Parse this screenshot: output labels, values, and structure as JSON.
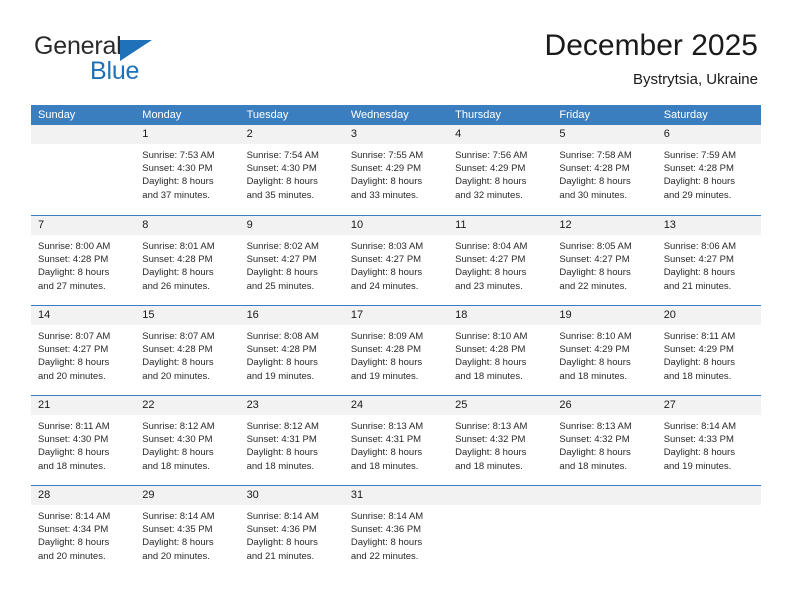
{
  "brand": {
    "name_part1": "General",
    "name_part2": "Blue",
    "accent_color": "#1f72b8"
  },
  "header": {
    "title": "December 2025",
    "subtitle": "Bystrytsia, Ukraine"
  },
  "theme": {
    "header_row_color": "#3b7ec0",
    "daynum_band_color": "#f2f2f2",
    "text_color": "#1a1a1a"
  },
  "weekdays": [
    "Sunday",
    "Monday",
    "Tuesday",
    "Wednesday",
    "Thursday",
    "Friday",
    "Saturday"
  ],
  "weeks": [
    [
      {
        "day": "",
        "lines": []
      },
      {
        "day": "1",
        "lines": [
          "Sunrise: 7:53 AM",
          "Sunset: 4:30 PM",
          "Daylight: 8 hours",
          "and 37 minutes."
        ]
      },
      {
        "day": "2",
        "lines": [
          "Sunrise: 7:54 AM",
          "Sunset: 4:30 PM",
          "Daylight: 8 hours",
          "and 35 minutes."
        ]
      },
      {
        "day": "3",
        "lines": [
          "Sunrise: 7:55 AM",
          "Sunset: 4:29 PM",
          "Daylight: 8 hours",
          "and 33 minutes."
        ]
      },
      {
        "day": "4",
        "lines": [
          "Sunrise: 7:56 AM",
          "Sunset: 4:29 PM",
          "Daylight: 8 hours",
          "and 32 minutes."
        ]
      },
      {
        "day": "5",
        "lines": [
          "Sunrise: 7:58 AM",
          "Sunset: 4:28 PM",
          "Daylight: 8 hours",
          "and 30 minutes."
        ]
      },
      {
        "day": "6",
        "lines": [
          "Sunrise: 7:59 AM",
          "Sunset: 4:28 PM",
          "Daylight: 8 hours",
          "and 29 minutes."
        ]
      }
    ],
    [
      {
        "day": "7",
        "lines": [
          "Sunrise: 8:00 AM",
          "Sunset: 4:28 PM",
          "Daylight: 8 hours",
          "and 27 minutes."
        ]
      },
      {
        "day": "8",
        "lines": [
          "Sunrise: 8:01 AM",
          "Sunset: 4:28 PM",
          "Daylight: 8 hours",
          "and 26 minutes."
        ]
      },
      {
        "day": "9",
        "lines": [
          "Sunrise: 8:02 AM",
          "Sunset: 4:27 PM",
          "Daylight: 8 hours",
          "and 25 minutes."
        ]
      },
      {
        "day": "10",
        "lines": [
          "Sunrise: 8:03 AM",
          "Sunset: 4:27 PM",
          "Daylight: 8 hours",
          "and 24 minutes."
        ]
      },
      {
        "day": "11",
        "lines": [
          "Sunrise: 8:04 AM",
          "Sunset: 4:27 PM",
          "Daylight: 8 hours",
          "and 23 minutes."
        ]
      },
      {
        "day": "12",
        "lines": [
          "Sunrise: 8:05 AM",
          "Sunset: 4:27 PM",
          "Daylight: 8 hours",
          "and 22 minutes."
        ]
      },
      {
        "day": "13",
        "lines": [
          "Sunrise: 8:06 AM",
          "Sunset: 4:27 PM",
          "Daylight: 8 hours",
          "and 21 minutes."
        ]
      }
    ],
    [
      {
        "day": "14",
        "lines": [
          "Sunrise: 8:07 AM",
          "Sunset: 4:27 PM",
          "Daylight: 8 hours",
          "and 20 minutes."
        ]
      },
      {
        "day": "15",
        "lines": [
          "Sunrise: 8:07 AM",
          "Sunset: 4:28 PM",
          "Daylight: 8 hours",
          "and 20 minutes."
        ]
      },
      {
        "day": "16",
        "lines": [
          "Sunrise: 8:08 AM",
          "Sunset: 4:28 PM",
          "Daylight: 8 hours",
          "and 19 minutes."
        ]
      },
      {
        "day": "17",
        "lines": [
          "Sunrise: 8:09 AM",
          "Sunset: 4:28 PM",
          "Daylight: 8 hours",
          "and 19 minutes."
        ]
      },
      {
        "day": "18",
        "lines": [
          "Sunrise: 8:10 AM",
          "Sunset: 4:28 PM",
          "Daylight: 8 hours",
          "and 18 minutes."
        ]
      },
      {
        "day": "19",
        "lines": [
          "Sunrise: 8:10 AM",
          "Sunset: 4:29 PM",
          "Daylight: 8 hours",
          "and 18 minutes."
        ]
      },
      {
        "day": "20",
        "lines": [
          "Sunrise: 8:11 AM",
          "Sunset: 4:29 PM",
          "Daylight: 8 hours",
          "and 18 minutes."
        ]
      }
    ],
    [
      {
        "day": "21",
        "lines": [
          "Sunrise: 8:11 AM",
          "Sunset: 4:30 PM",
          "Daylight: 8 hours",
          "and 18 minutes."
        ]
      },
      {
        "day": "22",
        "lines": [
          "Sunrise: 8:12 AM",
          "Sunset: 4:30 PM",
          "Daylight: 8 hours",
          "and 18 minutes."
        ]
      },
      {
        "day": "23",
        "lines": [
          "Sunrise: 8:12 AM",
          "Sunset: 4:31 PM",
          "Daylight: 8 hours",
          "and 18 minutes."
        ]
      },
      {
        "day": "24",
        "lines": [
          "Sunrise: 8:13 AM",
          "Sunset: 4:31 PM",
          "Daylight: 8 hours",
          "and 18 minutes."
        ]
      },
      {
        "day": "25",
        "lines": [
          "Sunrise: 8:13 AM",
          "Sunset: 4:32 PM",
          "Daylight: 8 hours",
          "and 18 minutes."
        ]
      },
      {
        "day": "26",
        "lines": [
          "Sunrise: 8:13 AM",
          "Sunset: 4:32 PM",
          "Daylight: 8 hours",
          "and 18 minutes."
        ]
      },
      {
        "day": "27",
        "lines": [
          "Sunrise: 8:14 AM",
          "Sunset: 4:33 PM",
          "Daylight: 8 hours",
          "and 19 minutes."
        ]
      }
    ],
    [
      {
        "day": "28",
        "lines": [
          "Sunrise: 8:14 AM",
          "Sunset: 4:34 PM",
          "Daylight: 8 hours",
          "and 20 minutes."
        ]
      },
      {
        "day": "29",
        "lines": [
          "Sunrise: 8:14 AM",
          "Sunset: 4:35 PM",
          "Daylight: 8 hours",
          "and 20 minutes."
        ]
      },
      {
        "day": "30",
        "lines": [
          "Sunrise: 8:14 AM",
          "Sunset: 4:36 PM",
          "Daylight: 8 hours",
          "and 21 minutes."
        ]
      },
      {
        "day": "31",
        "lines": [
          "Sunrise: 8:14 AM",
          "Sunset: 4:36 PM",
          "Daylight: 8 hours",
          "and 22 minutes."
        ]
      },
      {
        "day": "",
        "lines": []
      },
      {
        "day": "",
        "lines": []
      },
      {
        "day": "",
        "lines": []
      }
    ]
  ]
}
